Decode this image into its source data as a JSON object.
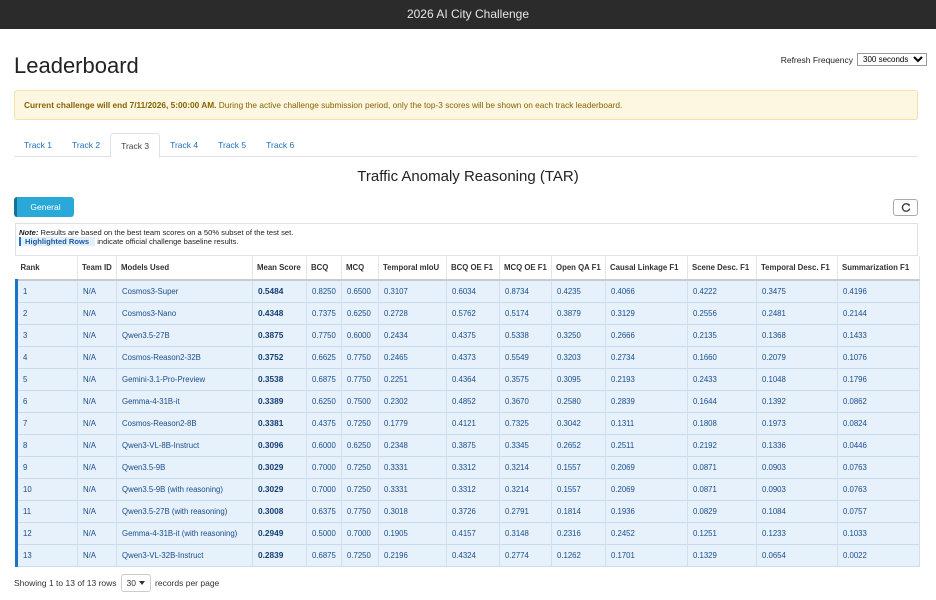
{
  "app": {
    "title": "2026 AI City Challenge"
  },
  "page": {
    "title": "Leaderboard"
  },
  "refresh": {
    "label": "Refresh Frequency",
    "selected": "300 seconds"
  },
  "alert": {
    "bold": "Current challenge will end 7/11/2026, 5:00:00 AM.",
    "text": " During the active challenge submission period, only the top-3 scores will be shown on each track leaderboard."
  },
  "tabs": [
    "Track 1",
    "Track 2",
    "Track 3",
    "Track 4",
    "Track 5",
    "Track 6"
  ],
  "active_tab": "Track 3",
  "track_title": "Traffic Anomaly Reasoning (TAR)",
  "toggle": {
    "label": "General"
  },
  "icons": {
    "refresh": "refresh-icon",
    "caret": "caret-down-icon"
  },
  "notes": {
    "note_label": "Note:",
    "note_text": " Results are based on the best team scores on a 50% subset of the test set.",
    "highlight_label": "Highlighted Rows",
    "highlight_text": " indicate official challenge baseline results."
  },
  "table": {
    "columns": [
      "Rank",
      "Team ID",
      "Models Used",
      "Mean Score",
      "BCQ",
      "MCQ",
      "Temporal mIoU",
      "BCQ OE F1",
      "MCQ OE F1",
      "Open QA F1",
      "Causal Linkage F1",
      "Scene Desc. F1",
      "Temporal Desc. F1",
      "Summarization F1"
    ],
    "rows": [
      [
        "1",
        "N/A",
        "Cosmos3-Super",
        "0.5484",
        "0.8250",
        "0.6500",
        "0.3107",
        "0.6034",
        "0.8734",
        "0.4235",
        "0.4066",
        "0.4222",
        "0.3475",
        "0.4196"
      ],
      [
        "2",
        "N/A",
        "Cosmos3-Nano",
        "0.4348",
        "0.7375",
        "0.6250",
        "0.2728",
        "0.5762",
        "0.5174",
        "0.3879",
        "0.3129",
        "0.2556",
        "0.2481",
        "0.2144"
      ],
      [
        "3",
        "N/A",
        "Qwen3.5-27B",
        "0.3875",
        "0.7750",
        "0.6000",
        "0.2434",
        "0.4375",
        "0.5338",
        "0.3250",
        "0.2666",
        "0.2135",
        "0.1368",
        "0.1433"
      ],
      [
        "4",
        "N/A",
        "Cosmos-Reason2-32B",
        "0.3752",
        "0.6625",
        "0.7750",
        "0.2465",
        "0.4373",
        "0.5549",
        "0.3203",
        "0.2734",
        "0.1660",
        "0.2079",
        "0.1076"
      ],
      [
        "5",
        "N/A",
        "Gemini-3.1-Pro-Preview",
        "0.3538",
        "0.6875",
        "0.7750",
        "0.2251",
        "0.4364",
        "0.3575",
        "0.3095",
        "0.2193",
        "0.2433",
        "0.1048",
        "0.1796"
      ],
      [
        "6",
        "N/A",
        "Gemma-4-31B-it",
        "0.3389",
        "0.6250",
        "0.7500",
        "0.2302",
        "0.4852",
        "0.3670",
        "0.2580",
        "0.2839",
        "0.1644",
        "0.1392",
        "0.0862"
      ],
      [
        "7",
        "N/A",
        "Cosmos-Reason2-8B",
        "0.3381",
        "0.4375",
        "0.7250",
        "0.1779",
        "0.4121",
        "0.7325",
        "0.3042",
        "0.1311",
        "0.1808",
        "0.1973",
        "0.0824"
      ],
      [
        "8",
        "N/A",
        "Qwen3-VL-8B-Instruct",
        "0.3096",
        "0.6000",
        "0.6250",
        "0.2348",
        "0.3875",
        "0.3345",
        "0.2652",
        "0.2511",
        "0.2192",
        "0.1336",
        "0.0446"
      ],
      [
        "9",
        "N/A",
        "Qwen3.5-9B",
        "0.3029",
        "0.7000",
        "0.7250",
        "0.3331",
        "0.3312",
        "0.3214",
        "0.1557",
        "0.2069",
        "0.0871",
        "0.0903",
        "0.0763"
      ],
      [
        "10",
        "N/A",
        "Qwen3.5-9B (with reasoning)",
        "0.3029",
        "0.7000",
        "0.7250",
        "0.3331",
        "0.3312",
        "0.3214",
        "0.1557",
        "0.2069",
        "0.0871",
        "0.0903",
        "0.0763"
      ],
      [
        "11",
        "N/A",
        "Qwen3.5-27B (with reasoning)",
        "0.3008",
        "0.6375",
        "0.7750",
        "0.3018",
        "0.3726",
        "0.2791",
        "0.1814",
        "0.1936",
        "0.0829",
        "0.1084",
        "0.0757"
      ],
      [
        "12",
        "N/A",
        "Gemma-4-31B-it (with reasoning)",
        "0.2949",
        "0.5000",
        "0.7000",
        "0.1905",
        "0.4157",
        "0.3148",
        "0.2316",
        "0.2452",
        "0.1251",
        "0.1233",
        "0.1033"
      ],
      [
        "13",
        "N/A",
        "Qwen3-VL-32B-Instruct",
        "0.2839",
        "0.6875",
        "0.7250",
        "0.2196",
        "0.4324",
        "0.2774",
        "0.1262",
        "0.1701",
        "0.1329",
        "0.0654",
        "0.0022"
      ]
    ]
  },
  "footer": {
    "showing": "Showing 1 to 13 of 13 rows",
    "page_size": "30",
    "per_page": "records per page"
  },
  "colors": {
    "accent": "#1a73c8",
    "toggle": "#29a9d8",
    "row_highlight": "#e6f1fb",
    "alert_bg": "#fdf6e0"
  }
}
